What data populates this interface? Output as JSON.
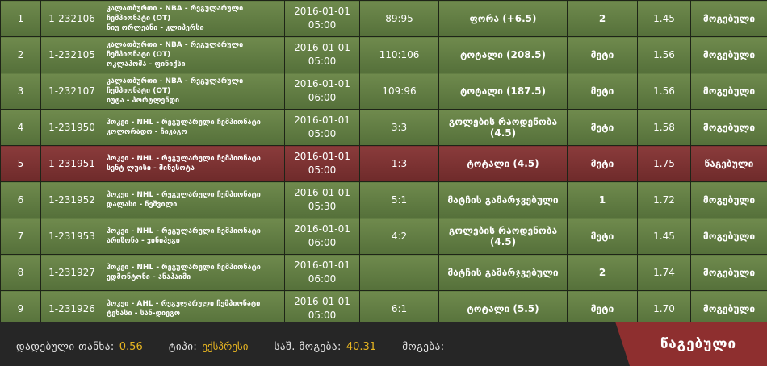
{
  "rows": [
    {
      "n": "1",
      "id": "1-232106",
      "ev1": "კალათბურთი - NBA - რეგულარული",
      "ev2": "ჩემპიონატი (OT)",
      "ev3": "ნიუ ორლეანი - კლიპერსი",
      "date": "2016-01-01",
      "time": "05:00",
      "score": "89:95",
      "bet": "ფორა (+6.5)",
      "pick": "2",
      "odds": "1.45",
      "result": "მოგებული",
      "status": "win"
    },
    {
      "n": "2",
      "id": "1-232105",
      "ev1": "კალათბურთი - NBA - რეგულარული",
      "ev2": "ჩემპიონატი (OT)",
      "ev3": "ოკლაჰომა - ფინიქსი",
      "date": "2016-01-01",
      "time": "05:00",
      "score": "110:106",
      "bet": "ტოტალი (208.5)",
      "pick": "მეტი",
      "odds": "1.56",
      "result": "მოგებული",
      "status": "win"
    },
    {
      "n": "3",
      "id": "1-232107",
      "ev1": "კალათბურთი - NBA - რეგულარული",
      "ev2": "ჩემპიონატი (OT)",
      "ev3": "იუტა - პორტლენდი",
      "date": "2016-01-01",
      "time": "06:00",
      "score": "109:96",
      "bet": "ტოტალი (187.5)",
      "pick": "მეტი",
      "odds": "1.56",
      "result": "მოგებული",
      "status": "win"
    },
    {
      "n": "4",
      "id": "1-231950",
      "ev1": "ჰოკეი - NHL - რეგულარული ჩემპიონატი",
      "ev2": "კოლორადო - ჩიკაგო",
      "ev3": "",
      "date": "2016-01-01",
      "time": "05:00",
      "score": "3:3",
      "bet": "გოლების რაოდენობა (4.5)",
      "pick": "მეტი",
      "odds": "1.58",
      "result": "მოგებული",
      "status": "win"
    },
    {
      "n": "5",
      "id": "1-231951",
      "ev1": "ჰოკეი - NHL - რეგულარული ჩემპიონატი",
      "ev2": "სენტ ლუისი - მინესოტა",
      "ev3": "",
      "date": "2016-01-01",
      "time": "05:00",
      "score": "1:3",
      "bet": "ტოტალი (4.5)",
      "pick": "მეტი",
      "odds": "1.75",
      "result": "წაგებული",
      "status": "lose"
    },
    {
      "n": "6",
      "id": "1-231952",
      "ev1": "ჰოკეი - NHL - რეგულარული ჩემპიონატი",
      "ev2": "დალასი - ნეშვილი",
      "ev3": "",
      "date": "2016-01-01",
      "time": "05:30",
      "score": "5:1",
      "bet": "მატჩის გამარჯვებული",
      "pick": "1",
      "odds": "1.72",
      "result": "მოგებული",
      "status": "win"
    },
    {
      "n": "7",
      "id": "1-231953",
      "ev1": "ჰოკეი - NHL - რეგულარული ჩემპიონატი",
      "ev2": "არიზონა - ვინიპეგი",
      "ev3": "",
      "date": "2016-01-01",
      "time": "06:00",
      "score": "4:2",
      "bet": "გოლების რაოდენობა (4.5)",
      "pick": "მეტი",
      "odds": "1.45",
      "result": "მოგებული",
      "status": "win"
    },
    {
      "n": "8",
      "id": "1-231927",
      "ev1": "ჰოკეი - NHL - რეგულარული ჩემპიონატი",
      "ev2": "ედმონტონი - ანაჰაიმი",
      "ev3": "",
      "date": "2016-01-01",
      "time": "06:00",
      "score": "",
      "bet": "მატჩის გამარჯვებული",
      "pick": "2",
      "odds": "1.74",
      "result": "მოგებული",
      "status": "win"
    },
    {
      "n": "9",
      "id": "1-231926",
      "ev1": "ჰოკეი - AHL - რეგულარული ჩემპიონატი",
      "ev2": "ტეხასი - სან-დიეგო",
      "ev3": "",
      "date": "2016-01-01",
      "time": "05:00",
      "score": "6:1",
      "bet": "ტოტალი (5.5)",
      "pick": "მეტი",
      "odds": "1.70",
      "result": "მოგებული",
      "status": "win"
    }
  ],
  "footer": {
    "stake_label": "დადებული თანხა:",
    "stake_value": "0.56",
    "type_label": "ტიპი:",
    "type_value": "ექსპრესი",
    "possible_label": "საშ. მოგება:",
    "possible_value": "40.31",
    "win_label": "მოგება:",
    "win_value": "",
    "status_text": "წაგებული"
  }
}
